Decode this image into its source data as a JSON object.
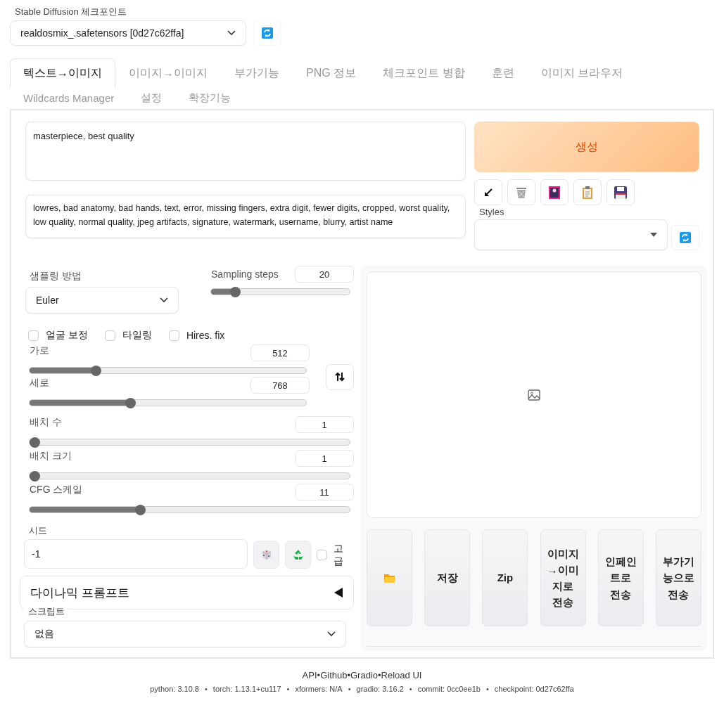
{
  "checkpoint": {
    "label": "Stable Diffusion 체크포인트",
    "value": "realdosmix_.safetensors [0d27c62ffa]"
  },
  "tabs": [
    {
      "label": "텍스트→이미지",
      "selected": true
    },
    {
      "label": "이미지→이미지",
      "selected": false
    },
    {
      "label": "부가기능",
      "selected": false
    },
    {
      "label": "PNG 정보",
      "selected": false
    },
    {
      "label": "체크포인트 병합",
      "selected": false
    },
    {
      "label": "훈련",
      "selected": false
    },
    {
      "label": "이미지 브라우저",
      "selected": false
    },
    {
      "label": "Wildcards Manager",
      "selected": false
    },
    {
      "label": "설정",
      "selected": false
    },
    {
      "label": "확장기능",
      "selected": false
    }
  ],
  "prompt": {
    "value": "masterpiece, best quality"
  },
  "negative_prompt": {
    "value": "lowres, bad anatomy, bad hands, text, error, missing fingers, extra digit, fewer digits, cropped, worst quality, low quality, normal quality, jpeg artifacts, signature, watermark, username, blurry, artist name"
  },
  "generate_button": "생성",
  "styles": {
    "label": "Styles"
  },
  "sampler": {
    "label": "샘플링 방법",
    "value": "Euler"
  },
  "sampling_steps": {
    "label": "Sampling steps",
    "value": "20",
    "level": 0.15
  },
  "options": [
    {
      "label": "얼굴 보정",
      "checked": false
    },
    {
      "label": "타일링",
      "checked": false
    },
    {
      "label": "Hires. fix",
      "checked": false
    }
  ],
  "size_sliders": [
    {
      "label": "가로",
      "value": "512",
      "level": 0.23
    },
    {
      "label": "세로",
      "value": "768",
      "level": 0.36
    }
  ],
  "sliders": [
    {
      "label": "배치 수",
      "value": "1",
      "level": 0
    },
    {
      "label": "배치 크기",
      "value": "1",
      "level": 0
    },
    {
      "label": "CFG 스케일",
      "value": "11",
      "level": 0.34
    }
  ],
  "seed": {
    "label": "시드",
    "value": "-1"
  },
  "extra": {
    "label": "고급",
    "checked": false
  },
  "dynamic_prompts": {
    "title": "다이나믹 프롬프트",
    "expanded": false
  },
  "script": {
    "label": "스크립트",
    "value": "없음"
  },
  "output_buttons": [
    {
      "kind": "folder"
    },
    {
      "kind": "text",
      "label": "저장"
    },
    {
      "kind": "text",
      "label": "Zip"
    },
    {
      "kind": "text",
      "label": "이미지→이미지로 전송"
    },
    {
      "kind": "text",
      "label": "인페인트로 전송"
    },
    {
      "kind": "text",
      "label": "부가기능으로 전송"
    }
  ],
  "footer": {
    "links": [
      "API",
      "Github",
      "Gradio",
      "Reload UI"
    ],
    "separator": "•",
    "versions": [
      "python: 3.10.8",
      "torch: 1.13.1+cu117",
      "xformers: N/A",
      "gradio: 3.16.2",
      "commit: 0cc0ee1b",
      "checkpoint: 0d27c62ffa"
    ]
  }
}
